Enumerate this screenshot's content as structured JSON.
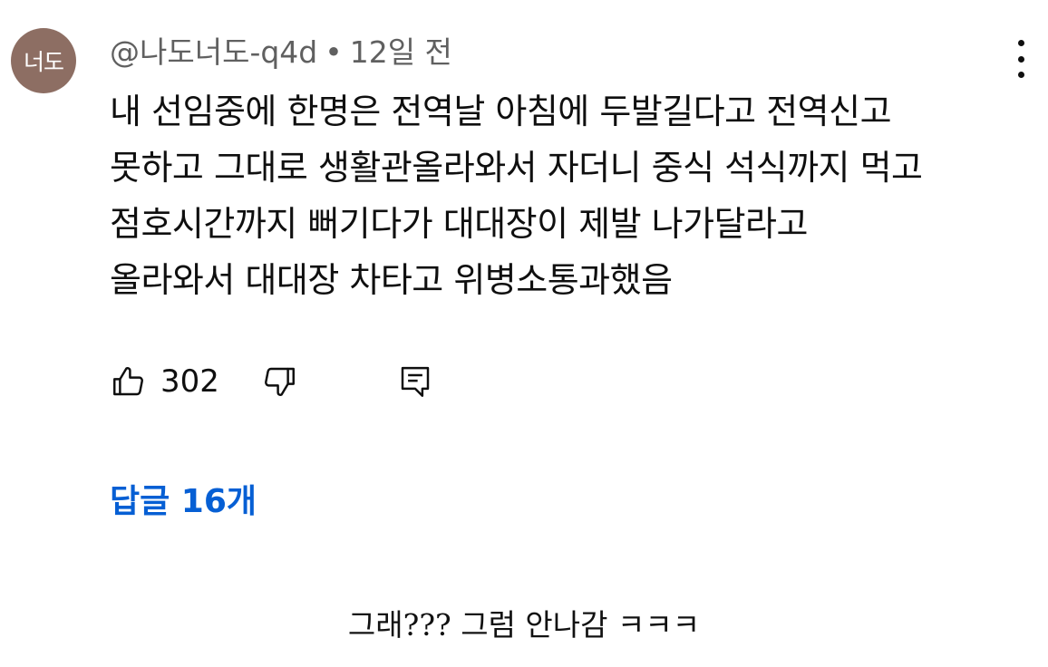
{
  "comment": {
    "avatar_text": "너도",
    "author": "@나도너도-q4d",
    "separator": "•",
    "time": "12일 전",
    "lines": [
      "내 선임중에 한명은 전역날 아침에 두발길다고 전역신고",
      "못하고 그대로 생활관올라와서 자더니 중식 석식까지 먹고",
      "점호시간까지 뻐기다가 대대장이 제발 나가달라고",
      "올라와서 대대장 차타고 위병소통과했음"
    ],
    "like_count": "302",
    "replies_label": "답글 16개",
    "icons": {
      "like": "thumbs-up-icon",
      "dislike": "thumbs-down-icon",
      "reply": "comment-icon",
      "menu": "more-vert-icon"
    }
  },
  "caption": "그래??? 그럼 안나감 ㅋㅋㅋ",
  "colors": {
    "avatar_bg": "#8d6e63",
    "link_blue": "#065fd4",
    "meta_gray": "#606060"
  }
}
